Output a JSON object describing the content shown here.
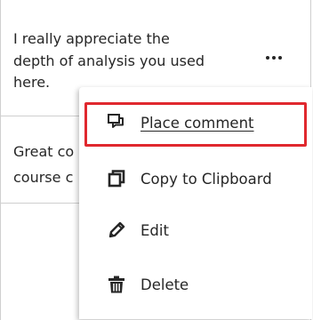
{
  "comments": [
    {
      "lines": [
        "I really appreciate the",
        "depth of analysis you used",
        "here."
      ]
    },
    {
      "lines": [
        "Great co",
        "course c"
      ]
    }
  ],
  "menu": {
    "items": [
      {
        "label": "Place comment",
        "icon": "comment-icon"
      },
      {
        "label": "Copy to Clipboard",
        "icon": "copy-icon"
      },
      {
        "label": "Edit",
        "icon": "pencil-icon"
      },
      {
        "label": "Delete",
        "icon": "trash-icon"
      }
    ]
  },
  "colors": {
    "focus_ring": "#e0282e",
    "text": "#262626",
    "divider": "#cfcfcf"
  }
}
